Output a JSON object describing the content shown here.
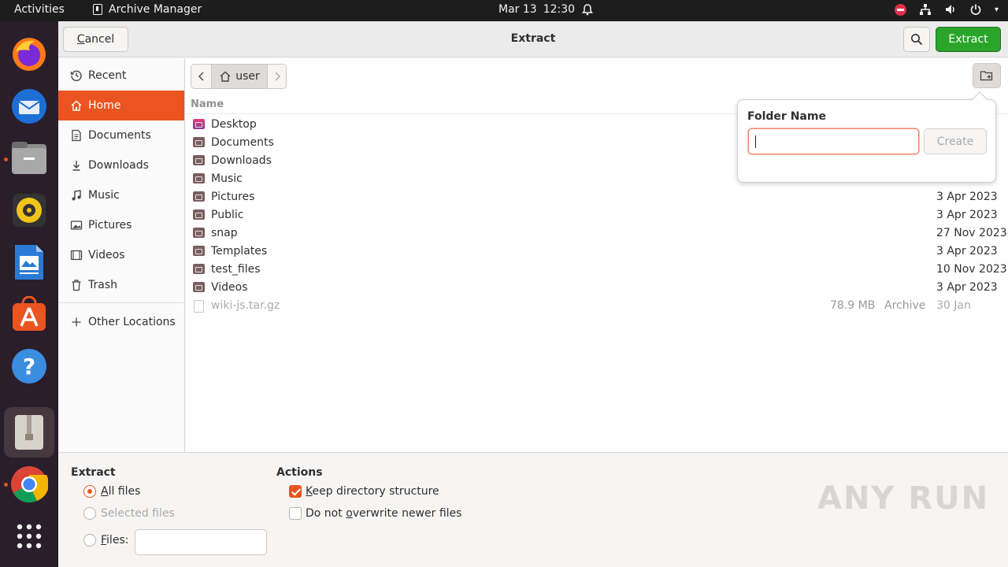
{
  "topbar": {
    "activities": "Activities",
    "app_name": "Archive Manager",
    "date": "Mar 13",
    "time": "12:30"
  },
  "dock": {
    "apps": [
      "firefox-icon",
      "thunderbird-icon",
      "files-icon",
      "rhythmbox-icon",
      "writer-icon",
      "app-center-icon",
      "help-icon",
      "archive-manager-icon",
      "chrome-icon",
      "show-apps-icon"
    ]
  },
  "header": {
    "cancel_prefix": "C",
    "cancel_rest": "ancel",
    "title": "Extract",
    "extract_label": "Extract"
  },
  "sidebar": {
    "items": [
      {
        "label": "Recent",
        "icon": "clock-icon"
      },
      {
        "label": "Home",
        "icon": "home-icon",
        "selected": true
      },
      {
        "label": "Documents",
        "icon": "document-icon"
      },
      {
        "label": "Downloads",
        "icon": "download-icon"
      },
      {
        "label": "Music",
        "icon": "music-icon"
      },
      {
        "label": "Pictures",
        "icon": "picture-icon"
      },
      {
        "label": "Videos",
        "icon": "video-icon"
      },
      {
        "label": "Trash",
        "icon": "trash-icon"
      },
      {
        "label": "Other Locations",
        "icon": "plus-icon"
      }
    ]
  },
  "pathbar": {
    "current": "user"
  },
  "files": {
    "column_name": "Name",
    "rows": [
      {
        "name": "Desktop",
        "size": "",
        "type": "",
        "date": ""
      },
      {
        "name": "Documents",
        "size": "",
        "type": "",
        "date": ""
      },
      {
        "name": "Downloads",
        "size": "",
        "type": "",
        "date": ""
      },
      {
        "name": "Music",
        "size": "",
        "type": "",
        "date": ""
      },
      {
        "name": "Pictures",
        "size": "",
        "type": "",
        "date": "3 Apr 2023"
      },
      {
        "name": "Public",
        "size": "",
        "type": "",
        "date": "3 Apr 2023"
      },
      {
        "name": "snap",
        "size": "",
        "type": "",
        "date": "27 Nov 2023"
      },
      {
        "name": "Templates",
        "size": "",
        "type": "",
        "date": "3 Apr 2023"
      },
      {
        "name": "test_files",
        "size": "",
        "type": "",
        "date": "10 Nov 2023"
      },
      {
        "name": "Videos",
        "size": "",
        "type": "",
        "date": "3 Apr 2023"
      },
      {
        "name": "wiki-js.tar.gz",
        "size": "78.9 MB",
        "type": "Archive",
        "date": "30 Jan"
      }
    ]
  },
  "popover": {
    "label": "Folder Name",
    "input_value": "",
    "create_label": "Create"
  },
  "options": {
    "extract_heading": "Extract",
    "all_files_prefix": "A",
    "all_files_rest": "ll files",
    "selected_files": "Selected files",
    "files_prefix": "F",
    "files_rest": "iles:",
    "files_value": "",
    "actions_heading": "Actions",
    "keep_prefix": "K",
    "keep_rest": "eep directory structure",
    "keep_checked": true,
    "no_overwrite_prefix": "Do not ",
    "no_overwrite_mn": "o",
    "no_overwrite_rest": "verwrite newer files",
    "no_overwrite_checked": false
  },
  "watermark": "ANY RUN"
}
